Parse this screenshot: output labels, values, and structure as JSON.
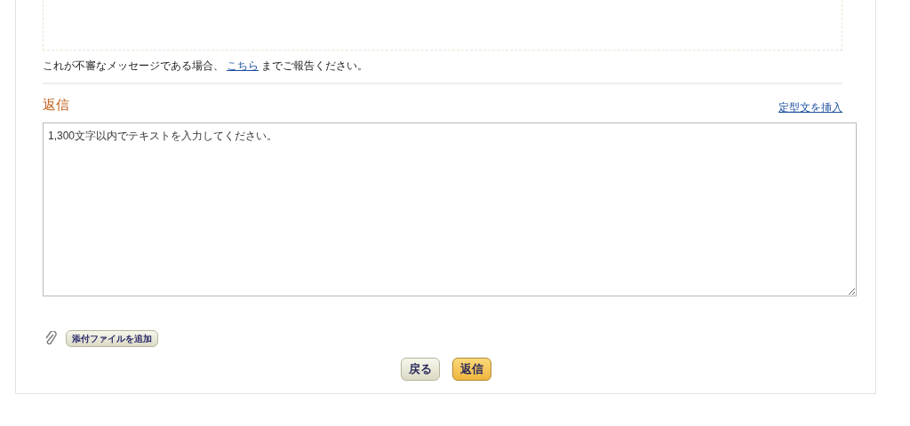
{
  "notice": {
    "before": "これが不審なメッセージである場合、",
    "link": "こちら",
    "after": "までご報告ください。"
  },
  "reply": {
    "heading": "返信",
    "template_link": "定型文を挿入",
    "placeholder": "1,300文字以内でテキストを入力してください。"
  },
  "attach_button": "添付ファイルを追加",
  "buttons": [
    {
      "label": "戻る",
      "kind": "secondary"
    },
    {
      "label": "返信",
      "kind": "primary"
    }
  ]
}
